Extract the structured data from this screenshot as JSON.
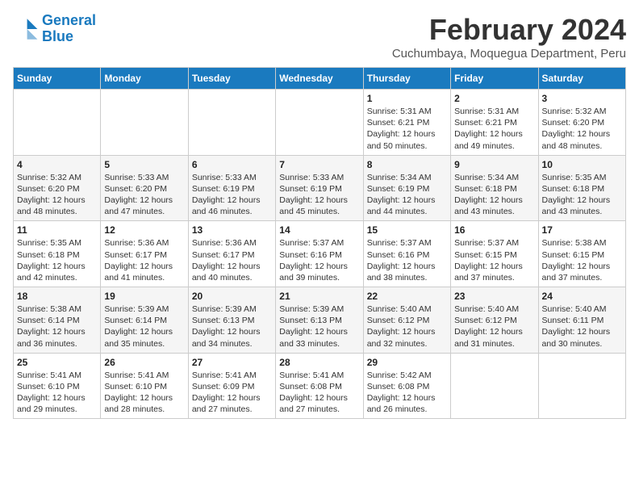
{
  "logo": {
    "line1": "General",
    "line2": "Blue"
  },
  "title": "February 2024",
  "location": "Cuchumbaya, Moquegua Department, Peru",
  "weekdays": [
    "Sunday",
    "Monday",
    "Tuesday",
    "Wednesday",
    "Thursday",
    "Friday",
    "Saturday"
  ],
  "weeks": [
    [
      {
        "day": "",
        "info": ""
      },
      {
        "day": "",
        "info": ""
      },
      {
        "day": "",
        "info": ""
      },
      {
        "day": "",
        "info": ""
      },
      {
        "day": "1",
        "info": "Sunrise: 5:31 AM\nSunset: 6:21 PM\nDaylight: 12 hours\nand 50 minutes."
      },
      {
        "day": "2",
        "info": "Sunrise: 5:31 AM\nSunset: 6:21 PM\nDaylight: 12 hours\nand 49 minutes."
      },
      {
        "day": "3",
        "info": "Sunrise: 5:32 AM\nSunset: 6:20 PM\nDaylight: 12 hours\nand 48 minutes."
      }
    ],
    [
      {
        "day": "4",
        "info": "Sunrise: 5:32 AM\nSunset: 6:20 PM\nDaylight: 12 hours\nand 48 minutes."
      },
      {
        "day": "5",
        "info": "Sunrise: 5:33 AM\nSunset: 6:20 PM\nDaylight: 12 hours\nand 47 minutes."
      },
      {
        "day": "6",
        "info": "Sunrise: 5:33 AM\nSunset: 6:19 PM\nDaylight: 12 hours\nand 46 minutes."
      },
      {
        "day": "7",
        "info": "Sunrise: 5:33 AM\nSunset: 6:19 PM\nDaylight: 12 hours\nand 45 minutes."
      },
      {
        "day": "8",
        "info": "Sunrise: 5:34 AM\nSunset: 6:19 PM\nDaylight: 12 hours\nand 44 minutes."
      },
      {
        "day": "9",
        "info": "Sunrise: 5:34 AM\nSunset: 6:18 PM\nDaylight: 12 hours\nand 43 minutes."
      },
      {
        "day": "10",
        "info": "Sunrise: 5:35 AM\nSunset: 6:18 PM\nDaylight: 12 hours\nand 43 minutes."
      }
    ],
    [
      {
        "day": "11",
        "info": "Sunrise: 5:35 AM\nSunset: 6:18 PM\nDaylight: 12 hours\nand 42 minutes."
      },
      {
        "day": "12",
        "info": "Sunrise: 5:36 AM\nSunset: 6:17 PM\nDaylight: 12 hours\nand 41 minutes."
      },
      {
        "day": "13",
        "info": "Sunrise: 5:36 AM\nSunset: 6:17 PM\nDaylight: 12 hours\nand 40 minutes."
      },
      {
        "day": "14",
        "info": "Sunrise: 5:37 AM\nSunset: 6:16 PM\nDaylight: 12 hours\nand 39 minutes."
      },
      {
        "day": "15",
        "info": "Sunrise: 5:37 AM\nSunset: 6:16 PM\nDaylight: 12 hours\nand 38 minutes."
      },
      {
        "day": "16",
        "info": "Sunrise: 5:37 AM\nSunset: 6:15 PM\nDaylight: 12 hours\nand 37 minutes."
      },
      {
        "day": "17",
        "info": "Sunrise: 5:38 AM\nSunset: 6:15 PM\nDaylight: 12 hours\nand 37 minutes."
      }
    ],
    [
      {
        "day": "18",
        "info": "Sunrise: 5:38 AM\nSunset: 6:14 PM\nDaylight: 12 hours\nand 36 minutes."
      },
      {
        "day": "19",
        "info": "Sunrise: 5:39 AM\nSunset: 6:14 PM\nDaylight: 12 hours\nand 35 minutes."
      },
      {
        "day": "20",
        "info": "Sunrise: 5:39 AM\nSunset: 6:13 PM\nDaylight: 12 hours\nand 34 minutes."
      },
      {
        "day": "21",
        "info": "Sunrise: 5:39 AM\nSunset: 6:13 PM\nDaylight: 12 hours\nand 33 minutes."
      },
      {
        "day": "22",
        "info": "Sunrise: 5:40 AM\nSunset: 6:12 PM\nDaylight: 12 hours\nand 32 minutes."
      },
      {
        "day": "23",
        "info": "Sunrise: 5:40 AM\nSunset: 6:12 PM\nDaylight: 12 hours\nand 31 minutes."
      },
      {
        "day": "24",
        "info": "Sunrise: 5:40 AM\nSunset: 6:11 PM\nDaylight: 12 hours\nand 30 minutes."
      }
    ],
    [
      {
        "day": "25",
        "info": "Sunrise: 5:41 AM\nSunset: 6:10 PM\nDaylight: 12 hours\nand 29 minutes."
      },
      {
        "day": "26",
        "info": "Sunrise: 5:41 AM\nSunset: 6:10 PM\nDaylight: 12 hours\nand 28 minutes."
      },
      {
        "day": "27",
        "info": "Sunrise: 5:41 AM\nSunset: 6:09 PM\nDaylight: 12 hours\nand 27 minutes."
      },
      {
        "day": "28",
        "info": "Sunrise: 5:41 AM\nSunset: 6:08 PM\nDaylight: 12 hours\nand 27 minutes."
      },
      {
        "day": "29",
        "info": "Sunrise: 5:42 AM\nSunset: 6:08 PM\nDaylight: 12 hours\nand 26 minutes."
      },
      {
        "day": "",
        "info": ""
      },
      {
        "day": "",
        "info": ""
      }
    ]
  ]
}
